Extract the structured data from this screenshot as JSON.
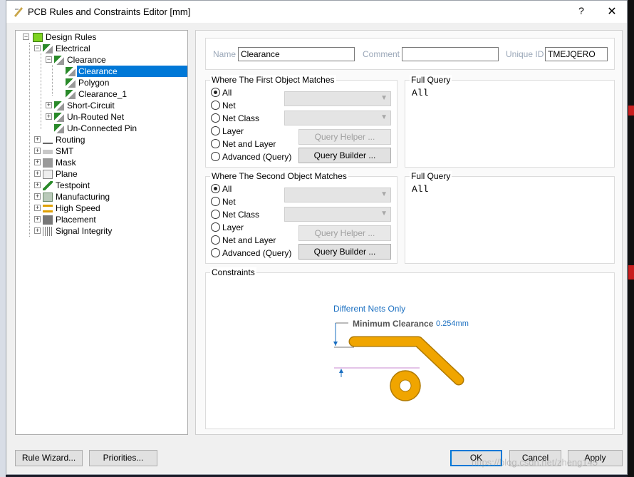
{
  "window": {
    "title": "PCB Rules and Constraints Editor [mm]",
    "help_glyph": "?",
    "close_glyph": "✕"
  },
  "tree": {
    "root": "Design Rules",
    "electrical": "Electrical",
    "clearance_group": "Clearance",
    "clearance_selected": "Clearance",
    "polygon": "Polygon",
    "clearance_1": "Clearance_1",
    "short_circuit": "Short-Circuit",
    "unrouted_net": "Un-Routed Net",
    "unconnected_pin": "Un-Connected Pin",
    "categories": [
      "Routing",
      "SMT",
      "Mask",
      "Plane",
      "Testpoint",
      "Manufacturing",
      "High Speed",
      "Placement",
      "Signal Integrity"
    ]
  },
  "header": {
    "name_label": "Name",
    "name_value": "Clearance",
    "comment_label": "Comment",
    "comment_value": "",
    "uid_label": "Unique ID",
    "uid_value": "TMEJQERO"
  },
  "first_match": {
    "title": "Where The First Object Matches",
    "options": [
      "All",
      "Net",
      "Net Class",
      "Layer",
      "Net and Layer",
      "Advanced (Query)"
    ],
    "query_helper": "Query Helper ...",
    "query_builder": "Query Builder ...",
    "full_query_title": "Full Query",
    "full_query": "All"
  },
  "second_match": {
    "title": "Where The Second Object Matches",
    "options": [
      "All",
      "Net",
      "Net Class",
      "Layer",
      "Net and Layer",
      "Advanced (Query)"
    ],
    "query_helper": "Query Helper ...",
    "query_builder": "Query Builder ...",
    "full_query_title": "Full Query",
    "full_query": "All"
  },
  "constraints": {
    "title": "Constraints",
    "different_nets": "Different Nets Only",
    "min_clearance_label": "Minimum Clearance",
    "min_clearance_value": "0.254mm",
    "colors": {
      "copper": "#f0a500",
      "accent": "#1a6fc1"
    }
  },
  "footer": {
    "rule_wizard": "Rule Wizard...",
    "priorities": "Priorities...",
    "ok": "OK",
    "cancel": "Cancel",
    "apply": "Apply"
  },
  "watermark": "https://blog.csdn.net/zheng145"
}
